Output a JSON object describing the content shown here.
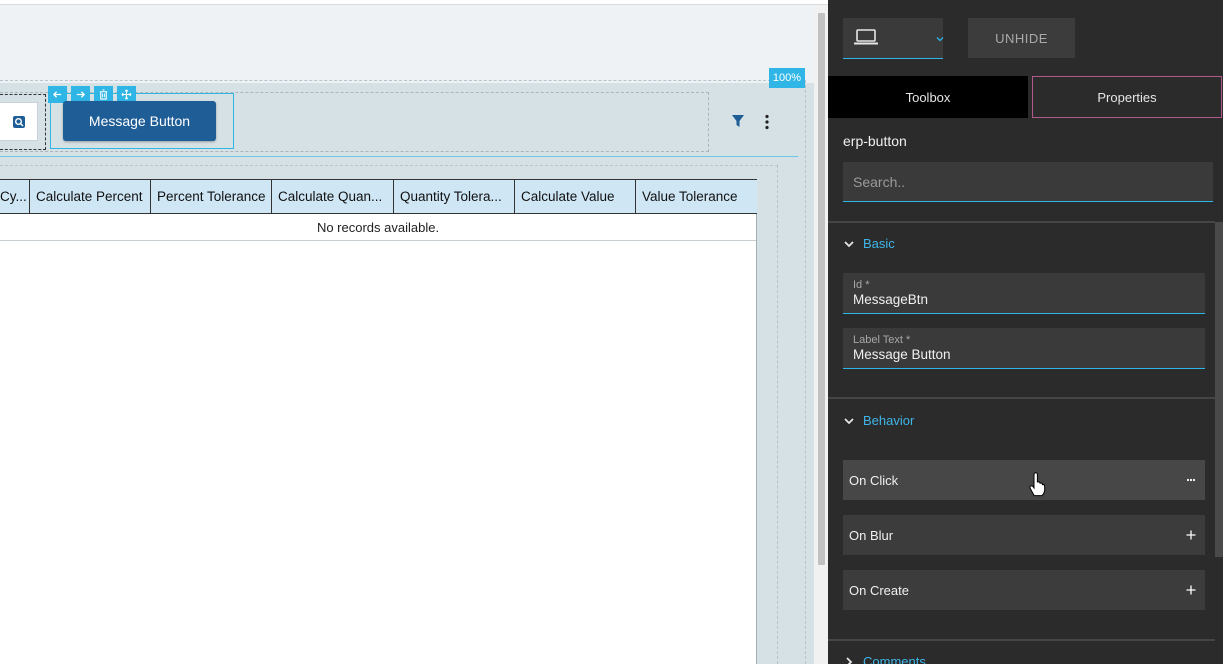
{
  "canvas": {
    "zoom": "100%",
    "message_button_label": "Message Button",
    "grid": {
      "columns": [
        "Cy...",
        "Calculate Percent",
        "Percent Tolerance",
        "Calculate Quan...",
        "Quantity Tolera...",
        "Calculate Value",
        "Value Tolerance"
      ],
      "empty_text": "No records available."
    }
  },
  "panel": {
    "unhide_label": "UNHIDE",
    "tabs": {
      "toolbox": "Toolbox",
      "properties": "Properties"
    },
    "component_name": "erp-button",
    "search_placeholder": "Search..",
    "sections": {
      "basic": {
        "title": "Basic",
        "id_label": "Id *",
        "id_value": "MessageBtn",
        "label_text_label": "Label Text *",
        "label_text_value": "Message Button"
      },
      "behavior": {
        "title": "Behavior",
        "events": [
          "On Click",
          "On Blur",
          "On Create"
        ]
      },
      "comments": {
        "title": "Comments"
      }
    }
  },
  "colors": {
    "accent": "#2fb6e6",
    "button_blue": "#1f5d96",
    "panel_bg": "#2b2b2b",
    "grid_header_bg": "#cfe6f5"
  },
  "icons": [
    "search-icon",
    "arrow-left-icon",
    "arrow-right-icon",
    "trash-icon",
    "move-icon",
    "filter-icon",
    "kebab-menu-icon",
    "laptop-icon",
    "chevron-down-icon",
    "more-icon",
    "plus-icon",
    "hand-cursor-icon"
  ]
}
